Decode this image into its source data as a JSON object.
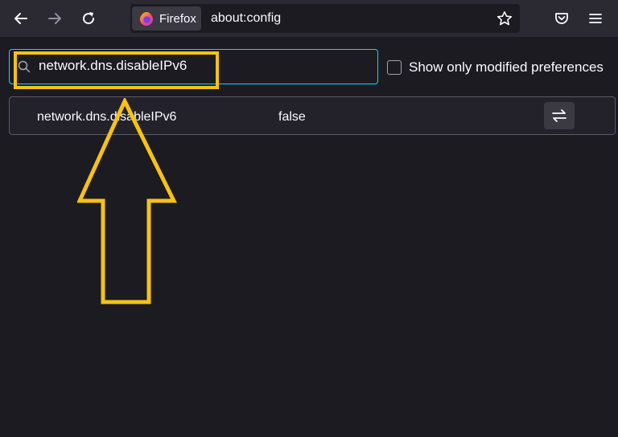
{
  "toolbar": {
    "back_icon": "back-arrow-icon",
    "forward_icon": "forward-arrow-icon",
    "reload_icon": "reload-icon",
    "identity_label": "Firefox",
    "url": "about:config",
    "bookmark_icon": "star-icon",
    "pocket_icon": "pocket-icon",
    "menu_icon": "hamburger-menu-icon"
  },
  "search": {
    "value": "network.dns.disableIPv6",
    "accent_color": "#00ddff"
  },
  "filter": {
    "modified_label": "Show only modified preferences",
    "checked": false
  },
  "preferences": [
    {
      "name": "network.dns.disableIPv6",
      "value": "false",
      "action_icon": "toggle-swap-icon"
    }
  ],
  "annotation": {
    "color": "#f6c214"
  }
}
